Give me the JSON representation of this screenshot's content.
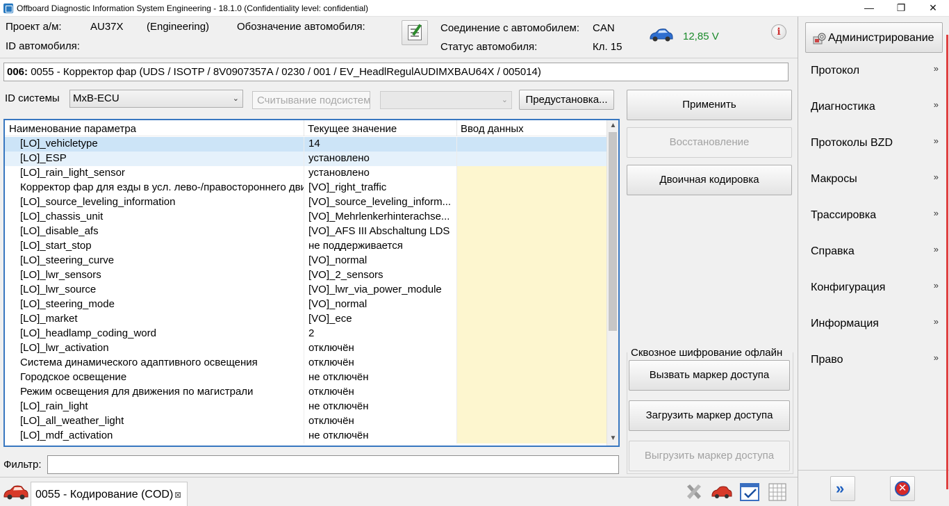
{
  "window": {
    "title": "Offboard Diagnostic Information System Engineering - 18.1.0 (Confidentiality level: confidential)",
    "minimize": "—",
    "restore": "❐",
    "close": "✕"
  },
  "header": {
    "project_label": "Проект а/м:",
    "project_value": "AU37X",
    "project_mode": "(Engineering)",
    "vehicle_designation_label": "Обозначение автомобиля:",
    "vehicle_id_label": "ID автомобиля:",
    "connection_label": "Соединение с автомобилем:",
    "connection_value": "CAN",
    "status_label": "Статус автомобиля:",
    "status_value": "Кл. 15",
    "voltage": "12,85 V",
    "info_glyph": "i"
  },
  "right_panel": {
    "admin_button": "Администрирование",
    "menu": [
      {
        "label": "Протокол"
      },
      {
        "label": "Диагностика"
      },
      {
        "label": "Протоколы BZD"
      },
      {
        "label": "Макросы"
      },
      {
        "label": "Трассировка"
      },
      {
        "label": "Справка"
      },
      {
        "label": "Конфигурация"
      },
      {
        "label": "Информация"
      },
      {
        "label": "Право"
      }
    ],
    "chevron": "»",
    "forward_glyph": "»",
    "close_glyph": "✕"
  },
  "control_unit": {
    "code": "006:",
    "title": " 0055 - Корректор фар  (UDS / ISOTP / 8V0907357A / 0230 / 001 / EV_HeadlRegulAUDIMXBAU64X / 005014)"
  },
  "controls": {
    "system_id_label": "ID системы",
    "system_id_value": "MxB-ECU",
    "read_subsystems_placeholder": "Считывание подсистем",
    "preset_button": "Предустановка...",
    "combo_arrow": "⌄"
  },
  "table": {
    "columns": [
      "Наименование параметра",
      "Текущее значение",
      "Ввод данных"
    ],
    "rows": [
      {
        "name": "[LO]_vehicletype",
        "value": "14",
        "input": ""
      },
      {
        "name": "[LO]_ESP",
        "value": "установлено",
        "input": ""
      },
      {
        "name": "[LO]_rain_light_sensor",
        "value": "установлено",
        "input": ""
      },
      {
        "name": "Корректор фар для езды в усл. лево-/правостороннего движения",
        "value": "[VO]_right_traffic",
        "input": ""
      },
      {
        "name": "[LO]_source_leveling_information",
        "value": "[VO]_source_leveling_inform...",
        "input": ""
      },
      {
        "name": "[LO]_chassis_unit",
        "value": "[VO]_Mehrlenkerhinteraсhse...",
        "input": ""
      },
      {
        "name": "[LO]_disable_afs",
        "value": "[VO]_AFS III Abschaltung LDS",
        "input": ""
      },
      {
        "name": "[LO]_start_stop",
        "value": "не поддерживается",
        "input": ""
      },
      {
        "name": "[LO]_steering_curve",
        "value": "[VO]_normal",
        "input": ""
      },
      {
        "name": "[LO]_lwr_sensors",
        "value": "[VO]_2_sensors",
        "input": ""
      },
      {
        "name": "[LO]_lwr_source",
        "value": "[VO]_lwr_via_power_module",
        "input": ""
      },
      {
        "name": "[LO]_steering_mode",
        "value": "[VO]_normal",
        "input": ""
      },
      {
        "name": "[LO]_market",
        "value": "[VO]_ece",
        "input": ""
      },
      {
        "name": "[LO]_headlamp_coding_word",
        "value": "2",
        "input": ""
      },
      {
        "name": "[LO]_lwr_activation",
        "value": "отключён",
        "input": ""
      },
      {
        "name": "Система динамического адаптивного освещения",
        "value": "отключён",
        "input": ""
      },
      {
        "name": "Городское освещение",
        "value": "не отключён",
        "input": ""
      },
      {
        "name": "Режим освещения для движения по магистрали",
        "value": "отключён",
        "input": ""
      },
      {
        "name": "[LO]_rain_light",
        "value": "не отключён",
        "input": ""
      },
      {
        "name": "[LO]_all_weather_light",
        "value": "отключён",
        "input": ""
      },
      {
        "name": "[LO]_mdf_activation",
        "value": "не отключён",
        "input": ""
      }
    ],
    "scroll_up": "▲",
    "scroll_down": "▼"
  },
  "actions": {
    "apply": "Применить",
    "restore": "Восстановление",
    "binary_coding": "Двоичная кодировка",
    "encryption_group": "Сквозное шифрование офлайн",
    "call_token": "Вызвать маркер доступа",
    "load_token": "Загрузить маркер доступа",
    "unload_token": "Выгрузить маркер доступа"
  },
  "filter": {
    "label": "Фильтр:",
    "value": ""
  },
  "bottom": {
    "tab_label": "0055 - Кодирование (COD)",
    "tab_close": "⊠"
  },
  "colors": {
    "accent_blue": "#3877c0",
    "input_cell": "#fdf6cf",
    "selected_row": "#cce4f7",
    "voltage_green": "#1a8a2a"
  }
}
